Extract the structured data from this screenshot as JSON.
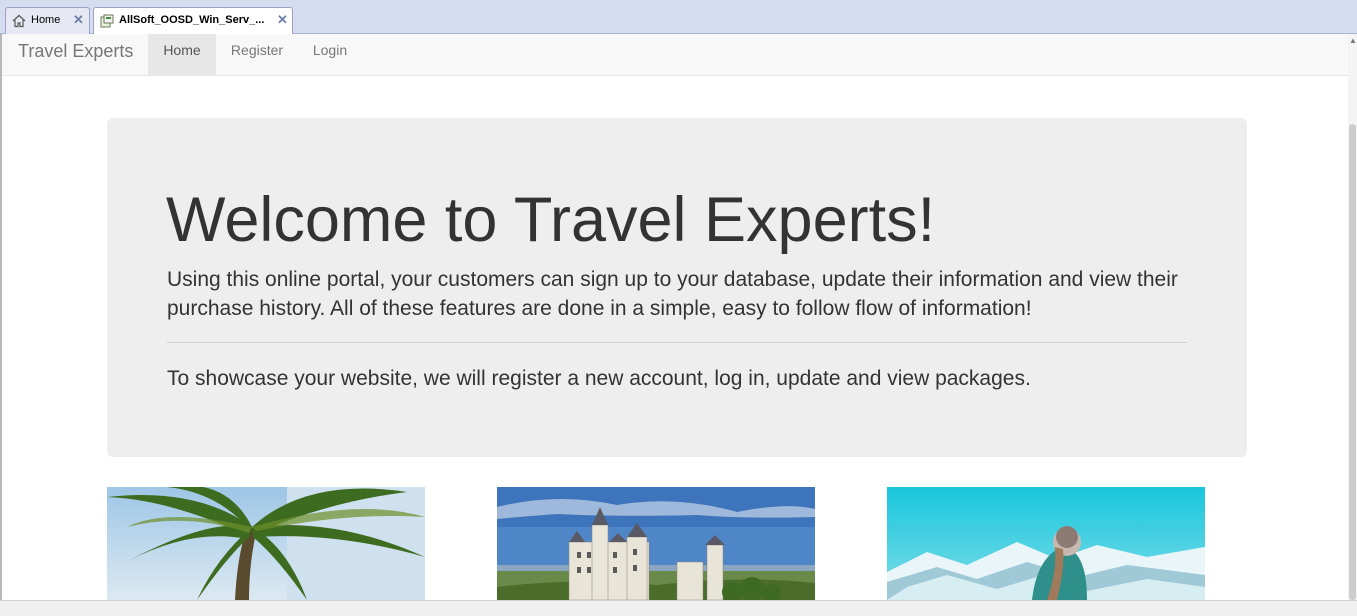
{
  "tabs": [
    {
      "label": "Home",
      "icon": "house-icon",
      "active": false
    },
    {
      "label": "AllSoft_OOSD_Win_Serv_...",
      "icon": "vm-icon",
      "active": true
    }
  ],
  "close_glyph": "✕",
  "navbar": {
    "brand": "Travel Experts",
    "items": [
      {
        "label": "Home",
        "active": true
      },
      {
        "label": "Register",
        "active": false
      },
      {
        "label": "Login",
        "active": false
      }
    ]
  },
  "jumbotron": {
    "title": "Welcome to Travel Experts!",
    "lead": "Using this online portal, your customers can sign up to your database, update their information and view their purchase history. All of these features are done in a simple, easy to follow flow of information!",
    "note": "To showcase your website, we will register a new account, log in, update and view packages."
  },
  "images": [
    {
      "name": "palm-tree-image"
    },
    {
      "name": "castle-image"
    },
    {
      "name": "snowy-mountain-image"
    }
  ],
  "colors": {
    "tabbar": "#d6dcef",
    "navbar": "#f8f8f8",
    "nav_active": "#e7e7e7",
    "jumbotron": "#eeeeee",
    "text": "#333333"
  }
}
